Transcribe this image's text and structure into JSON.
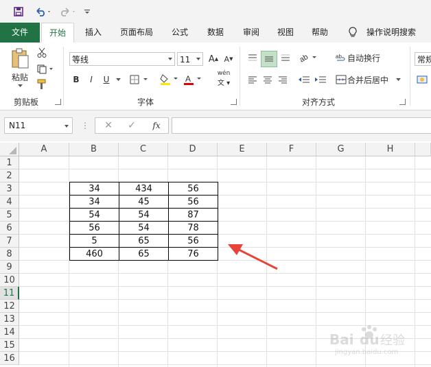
{
  "qat": {
    "save_icon": "save-icon",
    "undo_icon": "undo-icon",
    "redo_icon": "redo-icon",
    "customize_icon": "customize-icon"
  },
  "tabs": [
    {
      "label": "文件"
    },
    {
      "label": "开始"
    },
    {
      "label": "插入"
    },
    {
      "label": "页面布局"
    },
    {
      "label": "公式"
    },
    {
      "label": "数据"
    },
    {
      "label": "审阅"
    },
    {
      "label": "视图"
    },
    {
      "label": "帮助"
    },
    {
      "label": "操作说明搜索"
    }
  ],
  "ribbon": {
    "clipboard": {
      "paste_label": "粘贴",
      "group_label": "剪贴板"
    },
    "font": {
      "font_name": "等线",
      "font_size": "11",
      "bold": "B",
      "italic": "I",
      "underline": "U",
      "group_label": "字体",
      "phonetic_label": "wén"
    },
    "alignment": {
      "wrap_label": "自动换行",
      "merge_label": "合并后居中",
      "group_label": "对齐方式"
    },
    "number": {
      "format_label": "常规"
    }
  },
  "formula_bar": {
    "name_box": "N11",
    "fx_label": "fx",
    "value": ""
  },
  "columns": [
    "A",
    "B",
    "C",
    "D",
    "E",
    "F",
    "G",
    "H"
  ],
  "rows": [
    "1",
    "2",
    "3",
    "4",
    "5",
    "6",
    "7",
    "8",
    "9",
    "10",
    "11",
    "12",
    "13",
    "14",
    "15",
    "16"
  ],
  "table": [
    [
      "34",
      "434",
      "56"
    ],
    [
      "34",
      "45",
      "56"
    ],
    [
      "54",
      "54",
      "87"
    ],
    [
      "56",
      "54",
      "78"
    ],
    [
      "5",
      "65",
      "56"
    ],
    [
      "460",
      "65",
      "76"
    ]
  ],
  "active_row": "11",
  "annotation": {
    "arrow_color": "#e8443a"
  },
  "watermark": {
    "text": "Baidu经验",
    "sub": "jingyan.baidu.com"
  },
  "colors": {
    "excel_green": "#217346"
  }
}
